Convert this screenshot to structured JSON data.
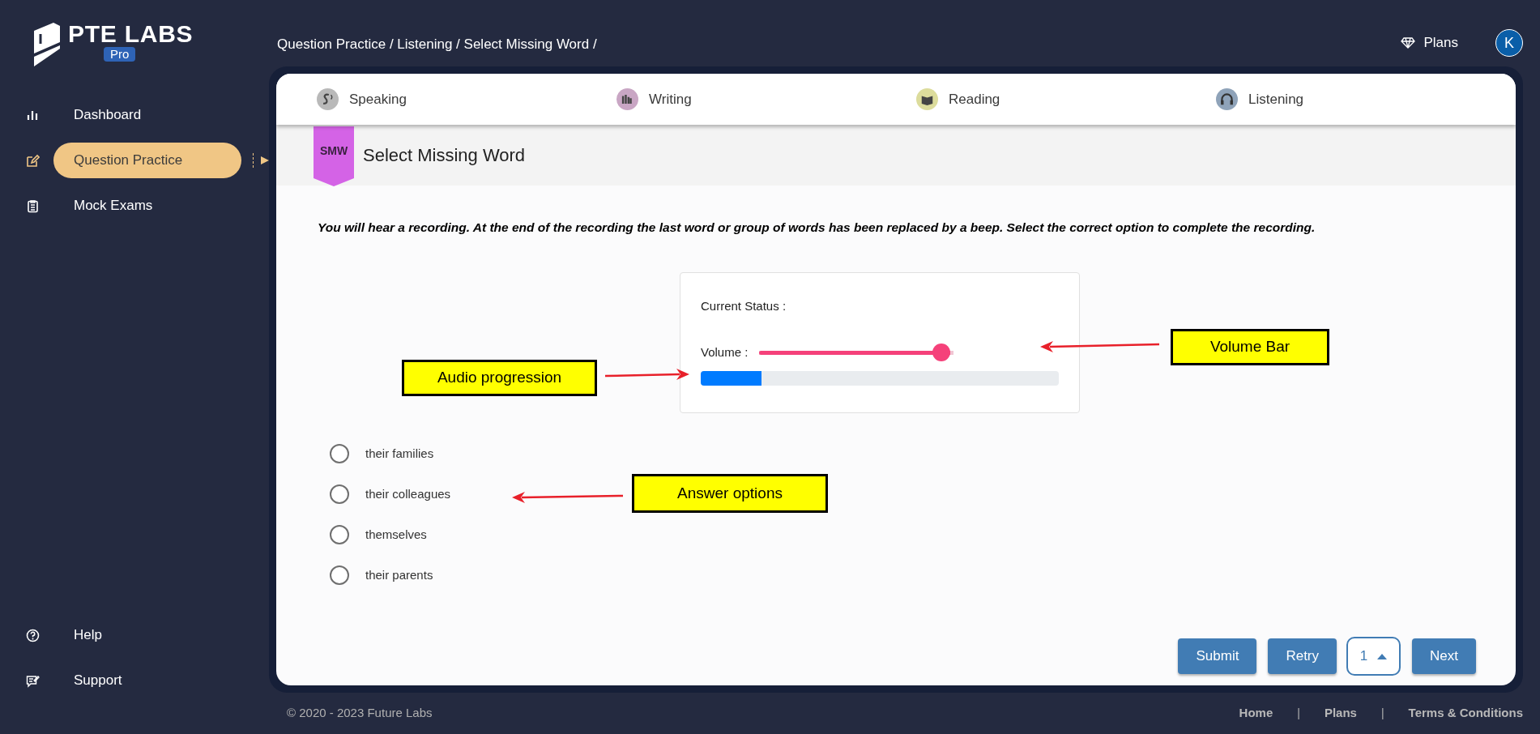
{
  "logo": {
    "name": "PTE LABS",
    "badge": "Pro"
  },
  "sidebar": {
    "items": [
      {
        "label": "Dashboard",
        "kind": "chart",
        "selected": false
      },
      {
        "label": "Question Practice",
        "kind": "edit",
        "selected": true
      },
      {
        "label": "Mock Exams",
        "kind": "clipboard",
        "selected": false
      }
    ],
    "bottom_items": [
      {
        "label": "Help",
        "kind": "help"
      },
      {
        "label": "Support",
        "kind": "support"
      }
    ]
  },
  "breadcrumb": "Question Practice / Listening / Select Missing Word /",
  "header": {
    "plans": "Plans",
    "avatar": "K"
  },
  "tabs": [
    {
      "label": "Speaking",
      "kind": "speaking",
      "color": "#b9b9b9"
    },
    {
      "label": "Writing",
      "kind": "writing",
      "color": "#c9a6c4"
    },
    {
      "label": "Reading",
      "kind": "reading",
      "color": "#dcdc9c"
    },
    {
      "label": "Listening",
      "kind": "listening",
      "color": "#8fa3b9"
    }
  ],
  "task": {
    "badge": "SMW",
    "title": "Select Missing Word",
    "instruction": "You will hear a recording. At the end of the recording the last word or group of words has been replaced by a beep. Select the correct option to complete the recording."
  },
  "player": {
    "status_label": "Current Status :",
    "volume_label": "Volume :",
    "volume": {
      "level": 0.98
    },
    "progress": {
      "level": 0.17
    }
  },
  "options": [
    {
      "label": "their families",
      "selected": false
    },
    {
      "label": "their colleagues",
      "selected": false
    },
    {
      "label": "themselves",
      "selected": false
    },
    {
      "label": "their parents",
      "selected": false
    }
  ],
  "actions": [
    {
      "kind": "button",
      "label": "Submit"
    },
    {
      "kind": "button",
      "label": "Retry"
    },
    {
      "kind": "select",
      "label": "1"
    },
    {
      "kind": "button",
      "label": "Next"
    }
  ],
  "annotations": [
    {
      "kind": "progress",
      "label": "Audio progression"
    },
    {
      "kind": "volume",
      "label": "Volume Bar"
    },
    {
      "kind": "options",
      "label": "Answer options"
    }
  ],
  "footer": {
    "copyright": "© 2020 - 2023 Future Labs",
    "links": [
      "Home",
      "Plans",
      "Terms & Conditions"
    ],
    "separator": "|"
  }
}
